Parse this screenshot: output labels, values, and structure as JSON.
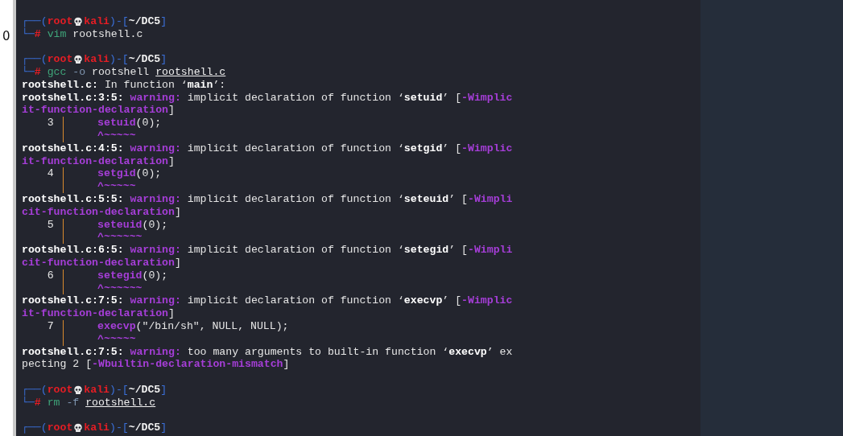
{
  "left_margin_text": "0",
  "terminal": {
    "lines": [
      {
        "kind": "blank"
      },
      {
        "kind": "prompt",
        "segments": [
          {
            "text": "┌──(",
            "kind": "frame"
          },
          {
            "text": "root",
            "kind": "user"
          },
          {
            "kind": "skull"
          },
          {
            "text": "kali",
            "kind": "user"
          },
          {
            "text": ")-[",
            "kind": "frame"
          },
          {
            "text": "~/DC5",
            "kind": "path"
          },
          {
            "text": "]",
            "kind": "frame"
          }
        ]
      },
      {
        "kind": "command",
        "corner": "└─",
        "symbol": "#",
        "command": "vim",
        "args": [
          {
            "text": "rootshell.c",
            "kind": "plain"
          }
        ]
      },
      {
        "kind": "blank"
      },
      {
        "kind": "prompt",
        "segments": [
          {
            "text": "┌──(",
            "kind": "frame"
          },
          {
            "text": "root",
            "kind": "user"
          },
          {
            "kind": "skull"
          },
          {
            "text": "kali",
            "kind": "user"
          },
          {
            "text": ")-[",
            "kind": "frame"
          },
          {
            "text": "~/DC5",
            "kind": "path"
          },
          {
            "text": "]",
            "kind": "frame"
          }
        ]
      },
      {
        "kind": "command",
        "corner": "└─",
        "symbol": "#",
        "command": "gcc",
        "args": [
          {
            "text": "-o",
            "kind": "option"
          },
          {
            "text": "rootshell",
            "kind": "plain"
          },
          {
            "text": "rootshell.c",
            "kind": "underline"
          }
        ]
      },
      {
        "kind": "message",
        "segments": [
          {
            "text": "rootshell.c:",
            "kind": "bold"
          },
          {
            "text": " In function ‘",
            "kind": "plain"
          },
          {
            "text": "main",
            "kind": "bold"
          },
          {
            "text": "’:",
            "kind": "plain"
          }
        ]
      },
      {
        "kind": "message",
        "segments": [
          {
            "text": "rootshell.c:3:5: ",
            "kind": "bold"
          },
          {
            "text": "warning:",
            "kind": "warn"
          },
          {
            "text": " implicit declaration of function ‘",
            "kind": "plain"
          },
          {
            "text": "setuid",
            "kind": "bold"
          },
          {
            "text": "’ [",
            "kind": "plain"
          },
          {
            "text": "-Wimplic",
            "kind": "flag"
          }
        ]
      },
      {
        "kind": "message",
        "segments": [
          {
            "text": "it-function-declaration",
            "kind": "flag"
          },
          {
            "text": "]",
            "kind": "plain"
          }
        ]
      },
      {
        "kind": "source",
        "number": "3",
        "code": [
          {
            "text": "setuid",
            "kind": "flag"
          },
          {
            "text": "(0);",
            "kind": "plain"
          }
        ]
      },
      {
        "kind": "marker",
        "marker": "^~~~~~"
      },
      {
        "kind": "message",
        "segments": [
          {
            "text": "rootshell.c:4:5: ",
            "kind": "bold"
          },
          {
            "text": "warning:",
            "kind": "warn"
          },
          {
            "text": " implicit declaration of function ‘",
            "kind": "plain"
          },
          {
            "text": "setgid",
            "kind": "bold"
          },
          {
            "text": "’ [",
            "kind": "plain"
          },
          {
            "text": "-Wimplic",
            "kind": "flag"
          }
        ]
      },
      {
        "kind": "message",
        "segments": [
          {
            "text": "it-function-declaration",
            "kind": "flag"
          },
          {
            "text": "]",
            "kind": "plain"
          }
        ]
      },
      {
        "kind": "source",
        "number": "4",
        "code": [
          {
            "text": "setgid",
            "kind": "flag"
          },
          {
            "text": "(0);",
            "kind": "plain"
          }
        ]
      },
      {
        "kind": "marker",
        "marker": "^~~~~~"
      },
      {
        "kind": "message",
        "segments": [
          {
            "text": "rootshell.c:5:5: ",
            "kind": "bold"
          },
          {
            "text": "warning:",
            "kind": "warn"
          },
          {
            "text": " implicit declaration of function ‘",
            "kind": "plain"
          },
          {
            "text": "seteuid",
            "kind": "bold"
          },
          {
            "text": "’ [",
            "kind": "plain"
          },
          {
            "text": "-Wimpli",
            "kind": "flag"
          }
        ]
      },
      {
        "kind": "message",
        "segments": [
          {
            "text": "cit-function-declaration",
            "kind": "flag"
          },
          {
            "text": "]",
            "kind": "plain"
          }
        ]
      },
      {
        "kind": "source",
        "number": "5",
        "code": [
          {
            "text": "seteuid",
            "kind": "flag"
          },
          {
            "text": "(0);",
            "kind": "plain"
          }
        ]
      },
      {
        "kind": "marker",
        "marker": "^~~~~~~"
      },
      {
        "kind": "message",
        "segments": [
          {
            "text": "rootshell.c:6:5: ",
            "kind": "bold"
          },
          {
            "text": "warning:",
            "kind": "warn"
          },
          {
            "text": " implicit declaration of function ‘",
            "kind": "plain"
          },
          {
            "text": "setegid",
            "kind": "bold"
          },
          {
            "text": "’ [",
            "kind": "plain"
          },
          {
            "text": "-Wimpli",
            "kind": "flag"
          }
        ]
      },
      {
        "kind": "message",
        "segments": [
          {
            "text": "cit-function-declaration",
            "kind": "flag"
          },
          {
            "text": "]",
            "kind": "plain"
          }
        ]
      },
      {
        "kind": "source",
        "number": "6",
        "code": [
          {
            "text": "setegid",
            "kind": "flag"
          },
          {
            "text": "(0);",
            "kind": "plain"
          }
        ]
      },
      {
        "kind": "marker",
        "marker": "^~~~~~~"
      },
      {
        "kind": "message",
        "segments": [
          {
            "text": "rootshell.c:7:5: ",
            "kind": "bold"
          },
          {
            "text": "warning:",
            "kind": "warn"
          },
          {
            "text": " implicit declaration of function ‘",
            "kind": "plain"
          },
          {
            "text": "execvp",
            "kind": "bold"
          },
          {
            "text": "’ [",
            "kind": "plain"
          },
          {
            "text": "-Wimplic",
            "kind": "flag"
          }
        ]
      },
      {
        "kind": "message",
        "segments": [
          {
            "text": "it-function-declaration",
            "kind": "flag"
          },
          {
            "text": "]",
            "kind": "plain"
          }
        ]
      },
      {
        "kind": "source",
        "number": "7",
        "code": [
          {
            "text": "execvp",
            "kind": "flag"
          },
          {
            "text": "(\"/bin/sh\", NULL, NULL);",
            "kind": "plain"
          }
        ]
      },
      {
        "kind": "marker",
        "marker": "^~~~~~"
      },
      {
        "kind": "message",
        "segments": [
          {
            "text": "rootshell.c:7:5: ",
            "kind": "bold"
          },
          {
            "text": "warning:",
            "kind": "warn"
          },
          {
            "text": " too many arguments to built-in function ‘",
            "kind": "plain"
          },
          {
            "text": "execvp",
            "kind": "bold"
          },
          {
            "text": "’ ex",
            "kind": "plain"
          }
        ]
      },
      {
        "kind": "message",
        "segments": [
          {
            "text": "pecting 2 [",
            "kind": "plain"
          },
          {
            "text": "-Wbuiltin-declaration-mismatch",
            "kind": "flag"
          },
          {
            "text": "]",
            "kind": "plain"
          }
        ]
      },
      {
        "kind": "blank"
      },
      {
        "kind": "prompt",
        "segments": [
          {
            "text": "┌──(",
            "kind": "frame"
          },
          {
            "text": "root",
            "kind": "user"
          },
          {
            "kind": "skull"
          },
          {
            "text": "kali",
            "kind": "user"
          },
          {
            "text": ")-[",
            "kind": "frame"
          },
          {
            "text": "~/DC5",
            "kind": "path"
          },
          {
            "text": "]",
            "kind": "frame"
          }
        ]
      },
      {
        "kind": "command",
        "corner": "└─",
        "symbol": "#",
        "command": "rm",
        "args": [
          {
            "text": "-f",
            "kind": "option"
          },
          {
            "text": "rootshell.c",
            "kind": "underline"
          }
        ]
      },
      {
        "kind": "blank"
      },
      {
        "kind": "prompt",
        "segments": [
          {
            "text": "┌──(",
            "kind": "frame"
          },
          {
            "text": "root",
            "kind": "user"
          },
          {
            "kind": "skull"
          },
          {
            "text": "kali",
            "kind": "user"
          },
          {
            "text": ")-[",
            "kind": "frame"
          },
          {
            "text": "~/DC5",
            "kind": "path"
          },
          {
            "text": "]",
            "kind": "frame"
          }
        ]
      }
    ]
  }
}
